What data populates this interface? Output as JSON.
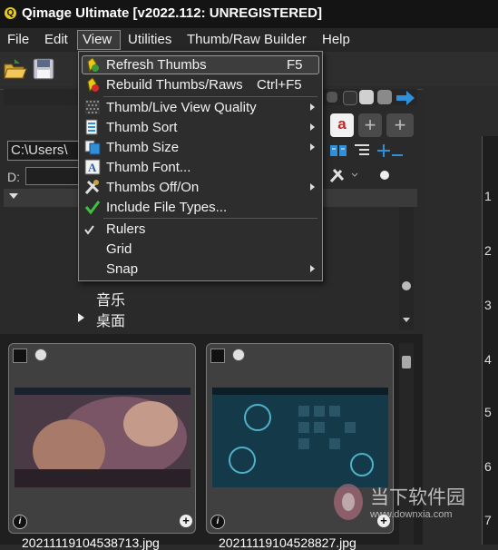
{
  "window": {
    "title": "Qimage Ultimate [v2022.112: UNREGISTERED]",
    "app_icon_letter": "Q"
  },
  "menubar": {
    "items": [
      {
        "label": "File"
      },
      {
        "label": "Edit"
      },
      {
        "label": "View"
      },
      {
        "label": "Utilities"
      },
      {
        "label": "Thumb/Raw Builder"
      },
      {
        "label": "Help"
      }
    ],
    "active": "View"
  },
  "view_menu": {
    "items": [
      {
        "label": "Refresh Thumbs",
        "shortcut": "F5",
        "icon": "refresh-icon",
        "highlighted": true
      },
      {
        "label": "Rebuild Thumbs/Raws",
        "shortcut": "Ctrl+F5",
        "icon": "rebuild-icon"
      },
      {
        "label": "Thumb/Live View Quality",
        "submenu": true,
        "icon": "quality-icon"
      },
      {
        "label": "Thumb Sort",
        "submenu": true,
        "icon": "sort-icon"
      },
      {
        "label": "Thumb Size",
        "submenu": true,
        "icon": "size-icon"
      },
      {
        "label": "Thumb Font...",
        "icon": "font-icon"
      },
      {
        "label": "Thumbs Off/On",
        "submenu": true,
        "icon": "tools-icon"
      },
      {
        "label": "Include File Types...",
        "icon": "checkmark-icon"
      },
      {
        "label": "Rulers",
        "checked": true
      },
      {
        "label": "Grid"
      },
      {
        "label": "Snap",
        "submenu": true
      }
    ]
  },
  "folder_panel": {
    "path": "C:\\Users\\",
    "drive_label": "D:",
    "tree_items": [
      {
        "label": "音乐"
      },
      {
        "label": "桌面"
      }
    ]
  },
  "ruler": {
    "numbers": [
      "1",
      "2",
      "3",
      "4",
      "5",
      "6",
      "7"
    ]
  },
  "thumbnails": [
    {
      "filename": "20211119104538713.jpg"
    },
    {
      "filename": "20211119104528827.jpg"
    }
  ],
  "watermark": {
    "text": "当下软件园",
    "url": "www.downxia.com"
  },
  "colors": {
    "accent": "#2f8fd8",
    "check_green": "#3cc43c",
    "icon_yellow": "#e8c81a"
  }
}
